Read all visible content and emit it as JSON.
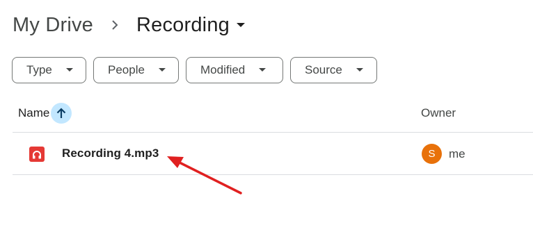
{
  "breadcrumb": {
    "root": "My Drive",
    "current": "Recording"
  },
  "filters": [
    {
      "label": "Type"
    },
    {
      "label": "People"
    },
    {
      "label": "Modified"
    },
    {
      "label": "Source"
    }
  ],
  "table": {
    "columns": {
      "name": "Name",
      "owner": "Owner"
    },
    "sort": "ascending",
    "rows": [
      {
        "name": "Recording 4.mp3",
        "icon": "audio-file-icon",
        "owner": "me",
        "owner_initial": "S",
        "owner_color": "#e8710a"
      }
    ]
  },
  "annotation": {
    "icon": "red-arrow",
    "color": "#e02020"
  },
  "colors": {
    "sort_highlight": "#c2e7ff",
    "file_icon": "#e53935"
  }
}
